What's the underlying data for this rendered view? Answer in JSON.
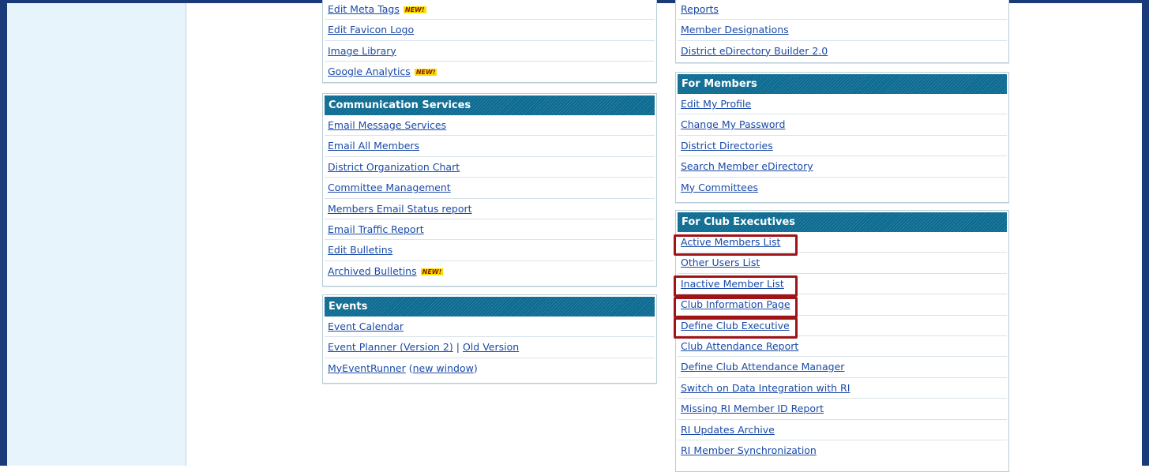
{
  "left_column": {
    "top_panel": {
      "items": [
        {
          "label": "Edit Meta Tags",
          "badge": "NEW!"
        },
        {
          "label": "Edit Favicon Logo"
        },
        {
          "label": "Image Library"
        },
        {
          "label": "Google Analytics",
          "badge": "NEW!"
        }
      ]
    },
    "communication_services": {
      "title": "Communication Services",
      "items": [
        {
          "label": "Email Message Services"
        },
        {
          "label": "Email All Members"
        },
        {
          "label": "District Organization Chart"
        },
        {
          "label": "Committee Management"
        },
        {
          "label": "Members Email Status report"
        },
        {
          "label": "Email Traffic Report"
        },
        {
          "label": "Edit Bulletins"
        },
        {
          "label": "Archived Bulletins",
          "badge": "NEW!"
        }
      ]
    },
    "events": {
      "title": "Events",
      "items": {
        "event_calendar": "Event Calendar",
        "event_planner": "Event Planner (Version 2)",
        "separator": "|",
        "old_version": "Old Version",
        "my_event_runner": "MyEventRunner",
        "open_paren": "(",
        "new_window": "new window",
        "close_paren": ")"
      }
    }
  },
  "right_column": {
    "top_panel": {
      "items": [
        {
          "label": "Reports"
        },
        {
          "label": "Member Designations"
        },
        {
          "label": "District eDirectory Builder 2.0"
        }
      ]
    },
    "for_members": {
      "title": "For Members",
      "items": [
        {
          "label": "Edit My Profile"
        },
        {
          "label": "Change My Password"
        },
        {
          "label": "District Directories"
        },
        {
          "label": "Search Member eDirectory"
        },
        {
          "label": "My Committees"
        }
      ]
    },
    "for_club_executives": {
      "title": "For Club Executives",
      "items": [
        {
          "label": "Active Members List",
          "highlighted": true
        },
        {
          "label": "Other Users List"
        },
        {
          "label": "Inactive Member List",
          "highlighted": true
        },
        {
          "label": "Club Information Page",
          "highlighted": true
        },
        {
          "label": "Define Club Executive",
          "highlighted": true
        },
        {
          "label": "Club Attendance Report"
        },
        {
          "label": "Define Club Attendance Manager"
        },
        {
          "label": "Switch on Data Integration with RI"
        },
        {
          "label": "Missing RI Member ID Report"
        },
        {
          "label": "RI Updates Archive"
        },
        {
          "label": "RI Member Synchronization"
        }
      ]
    }
  },
  "colors": {
    "frame": "#1b3a7a",
    "sidebar_bg": "#e8f4fb",
    "header_bg": "#0b6a91",
    "link": "#1a4aa8",
    "highlight_border": "#a01418",
    "badge_bg": "#f8e000"
  }
}
